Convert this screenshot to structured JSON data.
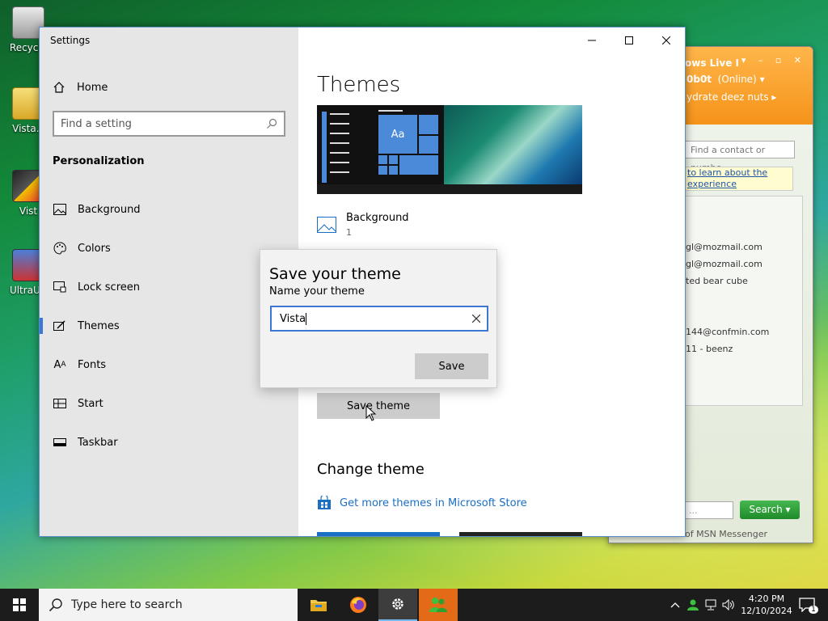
{
  "desktop": {
    "icons": [
      {
        "label": "Recycle"
      },
      {
        "label": "Vista.z"
      },
      {
        "label": "Vist"
      },
      {
        "label": "UltraUX"
      }
    ]
  },
  "msn": {
    "title_partial": "ows Live I",
    "user_partial": "0b0t",
    "status": "(Online)",
    "message_partial": "ydrate deez nuts",
    "find_placeholder": "Find a contact or numbe",
    "notice_line1": "to learn about the",
    "notice_line2": "experience",
    "contacts": [
      "gl@mozmail.com",
      "gl@mozmail.com",
      "ted bear cube",
      "144@confmin.com",
      "11 - beenz"
    ],
    "search_input": "...",
    "search_button": "Search",
    "footer": "of MSN Messenger"
  },
  "settings": {
    "window_title": "Settings",
    "home_label": "Home",
    "find_placeholder": "Find a setting",
    "section_title": "Personalization",
    "nav": [
      {
        "label": "Background",
        "icon": "picture-icon"
      },
      {
        "label": "Colors",
        "icon": "palette-icon"
      },
      {
        "label": "Lock screen",
        "icon": "lock-screen-icon"
      },
      {
        "label": "Themes",
        "icon": "brush-icon",
        "active": true
      },
      {
        "label": "Fonts",
        "icon": "font-icon"
      },
      {
        "label": "Start",
        "icon": "start-icon"
      },
      {
        "label": "Taskbar",
        "icon": "taskbar-icon"
      }
    ],
    "page_title": "Themes",
    "preview_tile_text": "Aa",
    "background_label": "Background",
    "background_value": "1",
    "save_theme_button": "Save theme",
    "change_theme_heading": "Change theme",
    "store_link": "Get more themes in Microsoft Store"
  },
  "dialog": {
    "title": "Save your theme",
    "label": "Name your theme",
    "input_value": "Vista",
    "save_button": "Save"
  },
  "taskbar": {
    "search_placeholder": "Type here to search",
    "time": "4:20 PM",
    "date": "12/10/2024",
    "notification_count": "1"
  },
  "colors": {
    "accent": "#3a78d4",
    "link": "#1a6fc4",
    "msn_orange": "#f5931a"
  }
}
